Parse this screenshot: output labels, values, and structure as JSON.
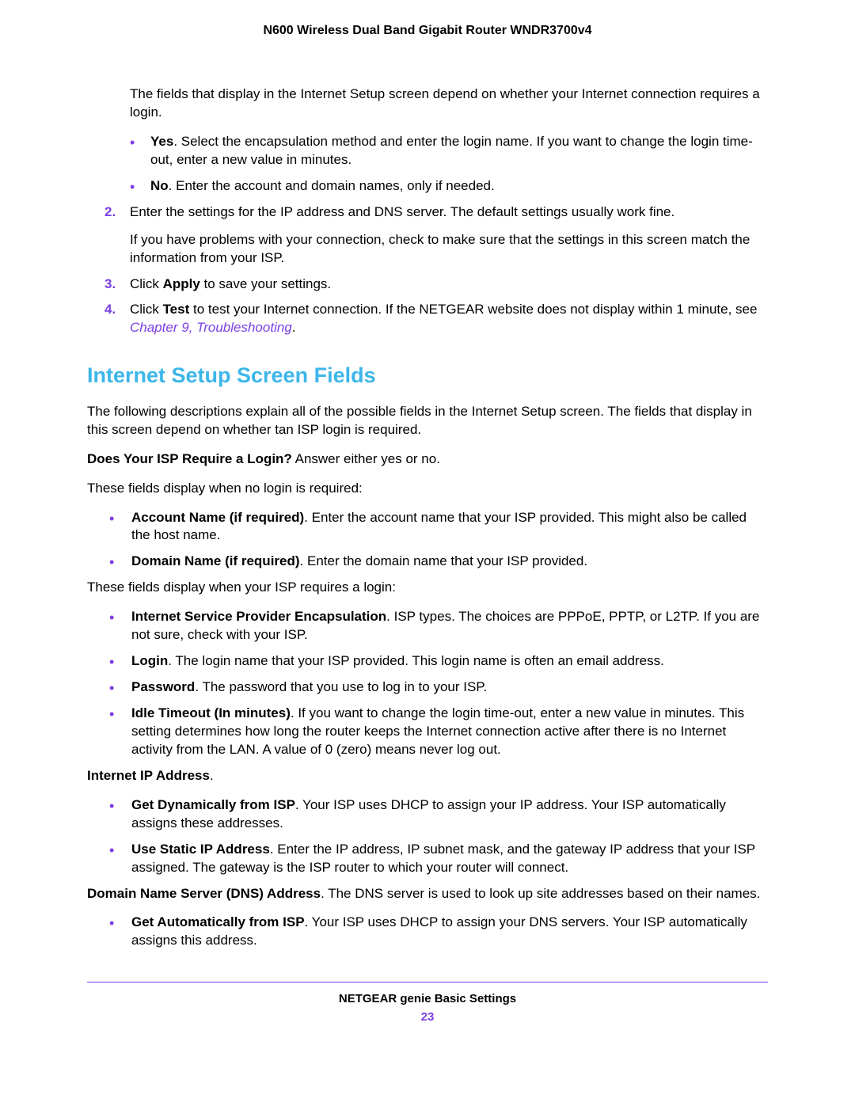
{
  "header": {
    "title": "N600 Wireless Dual Band Gigabit Router WNDR3700v4"
  },
  "intro": {
    "para1": "The fields that display in the Internet Setup screen depend on whether your Internet connection requires a login.",
    "yes_bold": "Yes",
    "yes_text": ". Select the encapsulation method and enter the login name. If you want to change the login time-out, enter a new value in minutes.",
    "no_bold": "No",
    "no_text": ". Enter the account and domain names, only if needed.",
    "step2_num": "2.",
    "step2": "Enter the settings for the IP address and DNS server. The default settings usually work fine.",
    "step2_sub": "If you have problems with your connection, check to make sure that the settings in this screen match the information from your ISP.",
    "step3_num": "3.",
    "step3_a": "Click ",
    "step3_bold": "Apply",
    "step3_b": " to save your settings.",
    "step4_num": "4.",
    "step4_a": "Click ",
    "step4_bold": "Test",
    "step4_b": " to test your Internet connection. If the NETGEAR website does not display within 1 minute, see ",
    "step4_link": "Chapter 9, Troubleshooting",
    "step4_c": "."
  },
  "section": {
    "title": "Internet Setup Screen Fields",
    "intro": "The following descriptions explain all of the possible fields in the Internet Setup screen. The fields that display in this screen depend on whether tan ISP login is required.",
    "isp_q_bold": "Does Your ISP Require a Login?",
    "isp_q_text": " Answer either yes or no.",
    "no_login_intro": "These fields display when no login is required:",
    "acct_bold": "Account Name (if required)",
    "acct_text": ". Enter the account name that your ISP provided. This might also be called the host name.",
    "domain_bold": "Domain Name (if required)",
    "domain_text": ". Enter the domain name that your ISP provided.",
    "login_intro": "These fields display when your ISP requires a login:",
    "encap_bold": "Internet Service Provider Encapsulation",
    "encap_text": ". ISP types. The choices are PPPoE, PPTP, or L2TP. If you are not sure, check with your ISP.",
    "login_bold": "Login",
    "login_text": ". The login name that your ISP provided. This login name is often an email address.",
    "pwd_bold": "Password",
    "pwd_text": ". The password that you use to log in to your ISP.",
    "idle_bold": "Idle Timeout (In minutes)",
    "idle_text": ". If you want to change the login time-out, enter a new value in minutes. This setting determines how long the router keeps the Internet connection active after there is no Internet activity from the LAN. A value of 0 (zero) means never log out.",
    "ip_heading_bold": "Internet IP Address",
    "ip_heading_text": ".",
    "dyn_bold": "Get Dynamically from ISP",
    "dyn_text": ". Your ISP uses DHCP to assign your IP address. Your ISP automatically assigns these addresses.",
    "static_bold": "Use Static IP Address",
    "static_text": ". Enter the IP address, IP subnet mask, and the gateway IP address that your ISP assigned. The gateway is the ISP router to which your router will connect.",
    "dns_heading_bold": "Domain Name Server (DNS) Address",
    "dns_heading_text": ". The DNS server is used to look up site addresses based on their names.",
    "dns_auto_bold": "Get Automatically from ISP",
    "dns_auto_text": ". Your ISP uses DHCP to assign your DNS servers. Your ISP automatically assigns this address."
  },
  "footer": {
    "title": "NETGEAR genie Basic Settings",
    "page": "23"
  }
}
